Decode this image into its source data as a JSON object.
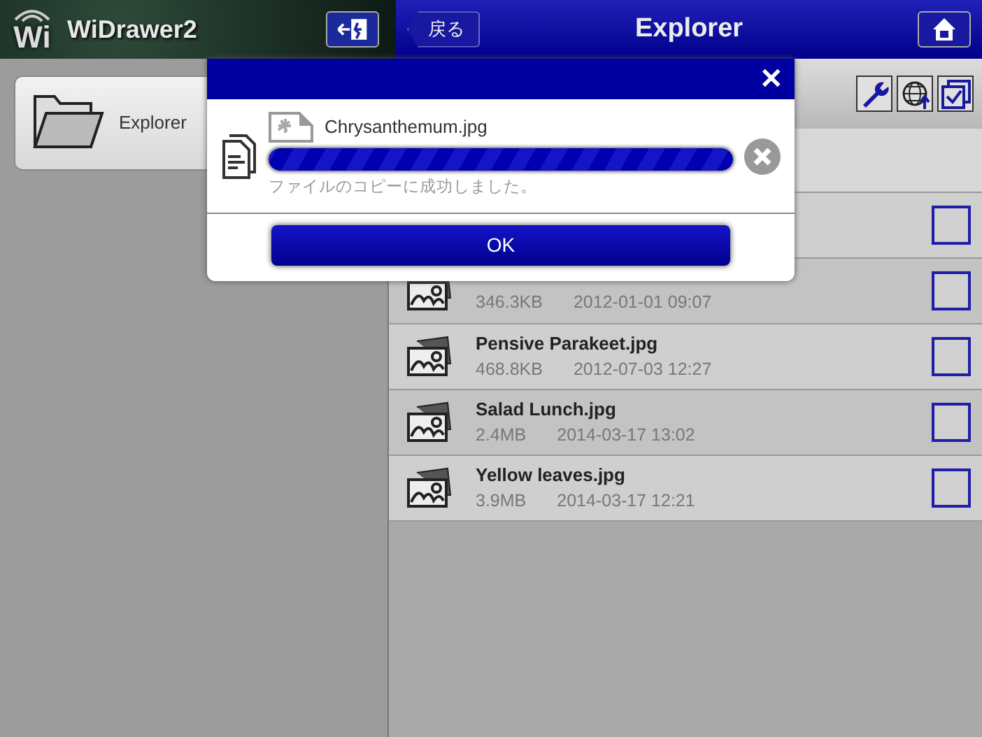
{
  "app": {
    "name": "WiDrawer2",
    "logo": "Wi"
  },
  "header": {
    "back": "戻る",
    "title": "Explorer"
  },
  "sidebar": {
    "items": [
      {
        "label": "Explorer",
        "selected": true
      }
    ]
  },
  "files": [
    {
      "checked": false
    },
    {
      "size": "346.3KB",
      "date": "2012-01-01 09:07",
      "checked": false
    },
    {
      "name": "Pensive Parakeet.jpg",
      "size": "468.8KB",
      "date": "2012-07-03 12:27",
      "checked": false
    },
    {
      "name": "Salad Lunch.jpg",
      "size": "2.4MB",
      "date": "2014-03-17 13:02",
      "checked": false
    },
    {
      "name": "Yellow leaves.jpg",
      "size": "3.9MB",
      "date": "2014-03-17 12:21",
      "checked": false
    }
  ],
  "dialog": {
    "close": "✕",
    "file": "Chrysanthemum.jpg",
    "level": 1,
    "message": "ファイルのコピーに成功しました。",
    "ok": "OK"
  }
}
